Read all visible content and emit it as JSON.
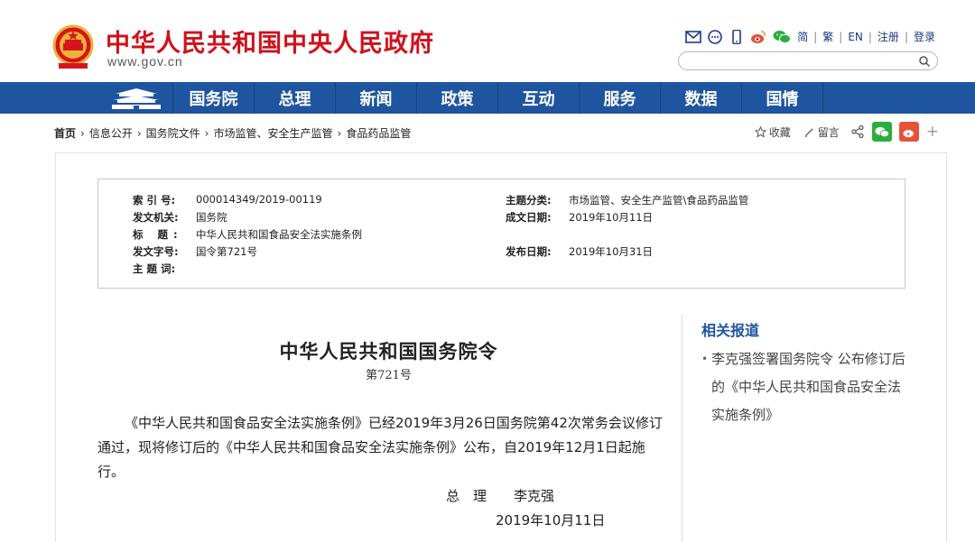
{
  "header": {
    "site_title": "中华人民共和国中央人民政府",
    "site_url": "www.gov.cn",
    "links": {
      "simplified": "简",
      "traditional": "繁",
      "english": "EN",
      "register": "注册",
      "login": "登录"
    },
    "search_placeholder": ""
  },
  "nav": {
    "items": [
      "国务院",
      "总理",
      "新闻",
      "政策",
      "互动",
      "服务",
      "数据",
      "国情"
    ]
  },
  "breadcrumb": [
    "首页",
    "信息公开",
    "国务院文件",
    "市场监管、安全生产监管",
    "食品药品监管"
  ],
  "tools": {
    "collect": "收藏",
    "comment": "留言"
  },
  "meta": {
    "index_label": "索 引 号:",
    "index_value": "000014349/2019-00119",
    "topic_label": "主题分类:",
    "topic_value": "市场监管、安全生产监管\\食品药品监管",
    "issuer_label": "发文机关:",
    "issuer_value": "国务院",
    "date_written_label": "成文日期:",
    "date_written_value": "2019年10月11日",
    "title_label": "标 题:",
    "title_value": "中华人民共和国食品安全法实施条例",
    "doc_no_label": "发文字号:",
    "doc_no_value": "国令第721号",
    "publish_label": "发布日期:",
    "publish_value": "2019年10月31日",
    "keywords_label": "主 题 词:"
  },
  "article": {
    "title": "中华人民共和国国务院令",
    "order_no": "第721号",
    "body": "《中华人民共和国食品安全法实施条例》已经2019年3月26日国务院第42次常务会议修订通过，现将修订后的《中华人民共和国食品安全法实施条例》公布，自2019年12月1日起施行。",
    "signature": "总　理　　李克强",
    "date": "2019年10月11日"
  },
  "related": {
    "title": "相关报道",
    "items": [
      "李克强签署国务院令 公布修订后的《中华人民共和国食品安全法实施条例》"
    ]
  },
  "colors": {
    "brand_red": "#d0111b",
    "nav_blue": "#1f55a0"
  }
}
